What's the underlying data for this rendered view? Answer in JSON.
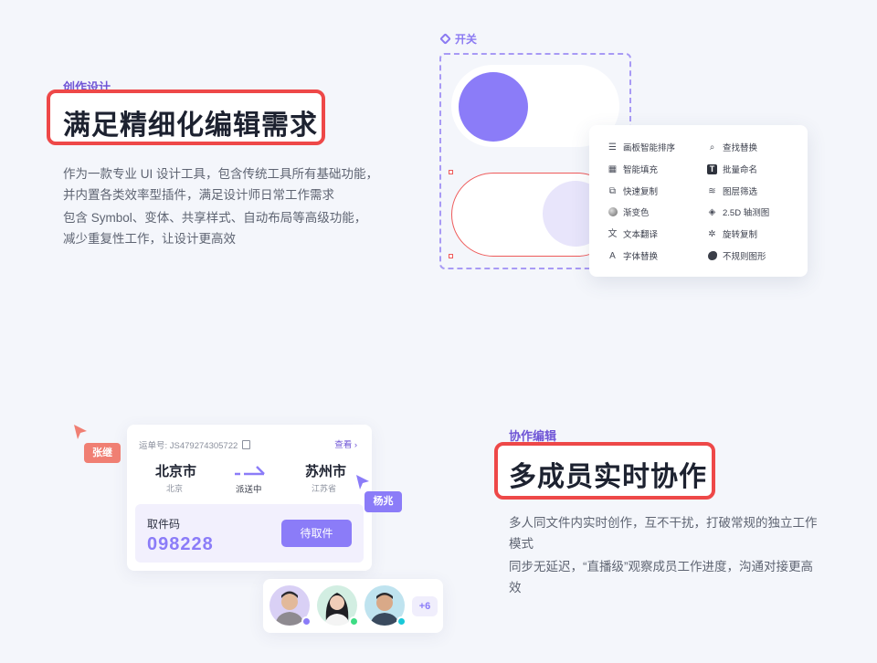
{
  "section_design": {
    "eyebrow": "创作设计",
    "headline": "满足精细化编辑需求",
    "para1": "作为一款专业 UI 设计工具，包含传统工具所有基础功能，并内置各类效率型插件，满足设计师日常工作需求",
    "para2": "包含 Symbol、变体、共享样式、自动布局等高级功能，减少重复性工作，让设计更高效"
  },
  "switch_demo": {
    "tag": "开关",
    "colors": {
      "accent": "#8b7cf8",
      "selection": "#ee5a5a",
      "knob_off": "#e8e5fb"
    }
  },
  "feature_menu": {
    "left": [
      {
        "label": "画板智能排序",
        "icon": "sort-bars-icon"
      },
      {
        "label": "智能填充",
        "icon": "grid-fill-icon"
      },
      {
        "label": "快速复制",
        "icon": "copy-squares-icon"
      },
      {
        "label": "渐变色",
        "icon": "gradient-circle-icon"
      },
      {
        "label": "文本翻译",
        "icon": "translate-icon"
      },
      {
        "label": "字体替换",
        "icon": "font-replace-icon"
      }
    ],
    "right": [
      {
        "label": "查找替换",
        "icon": "find-replace-icon"
      },
      {
        "label": "批量命名",
        "icon": "text-t-icon"
      },
      {
        "label": "图层筛选",
        "icon": "layers-icon"
      },
      {
        "label": "2.5D 轴测图",
        "icon": "cube-icon"
      },
      {
        "label": "旋转复制",
        "icon": "rotate-dots-icon"
      },
      {
        "label": "不规则图形",
        "icon": "blob-shape-icon"
      }
    ]
  },
  "section_collab": {
    "eyebrow": "协作编辑",
    "headline": "多成员实时协作",
    "para1": "多人同文件内实时创作，互不干扰，打破常规的独立工作模式",
    "para2": "同步无延迟，“直播级”观察成员工作进度，沟通对接更高效"
  },
  "parcel_card": {
    "tracking_label": "运单号: JS479274305722",
    "view_link": "查看 ›",
    "from_city": "北京市",
    "from_province": "北京",
    "status": "派送中",
    "to_city": "苏州市",
    "to_province": "江苏省",
    "pickup_label": "取件码",
    "pickup_code": "098228",
    "pickup_button": "待取件"
  },
  "cursors": {
    "user1": {
      "name": "张继",
      "color": "#f07f73"
    },
    "user2": {
      "name": "杨兆",
      "color": "#8b7cf8"
    }
  },
  "members": {
    "more_count": "+6",
    "status_colors": [
      "#8b7cf8",
      "#3ddc84",
      "#19c8d8"
    ]
  }
}
